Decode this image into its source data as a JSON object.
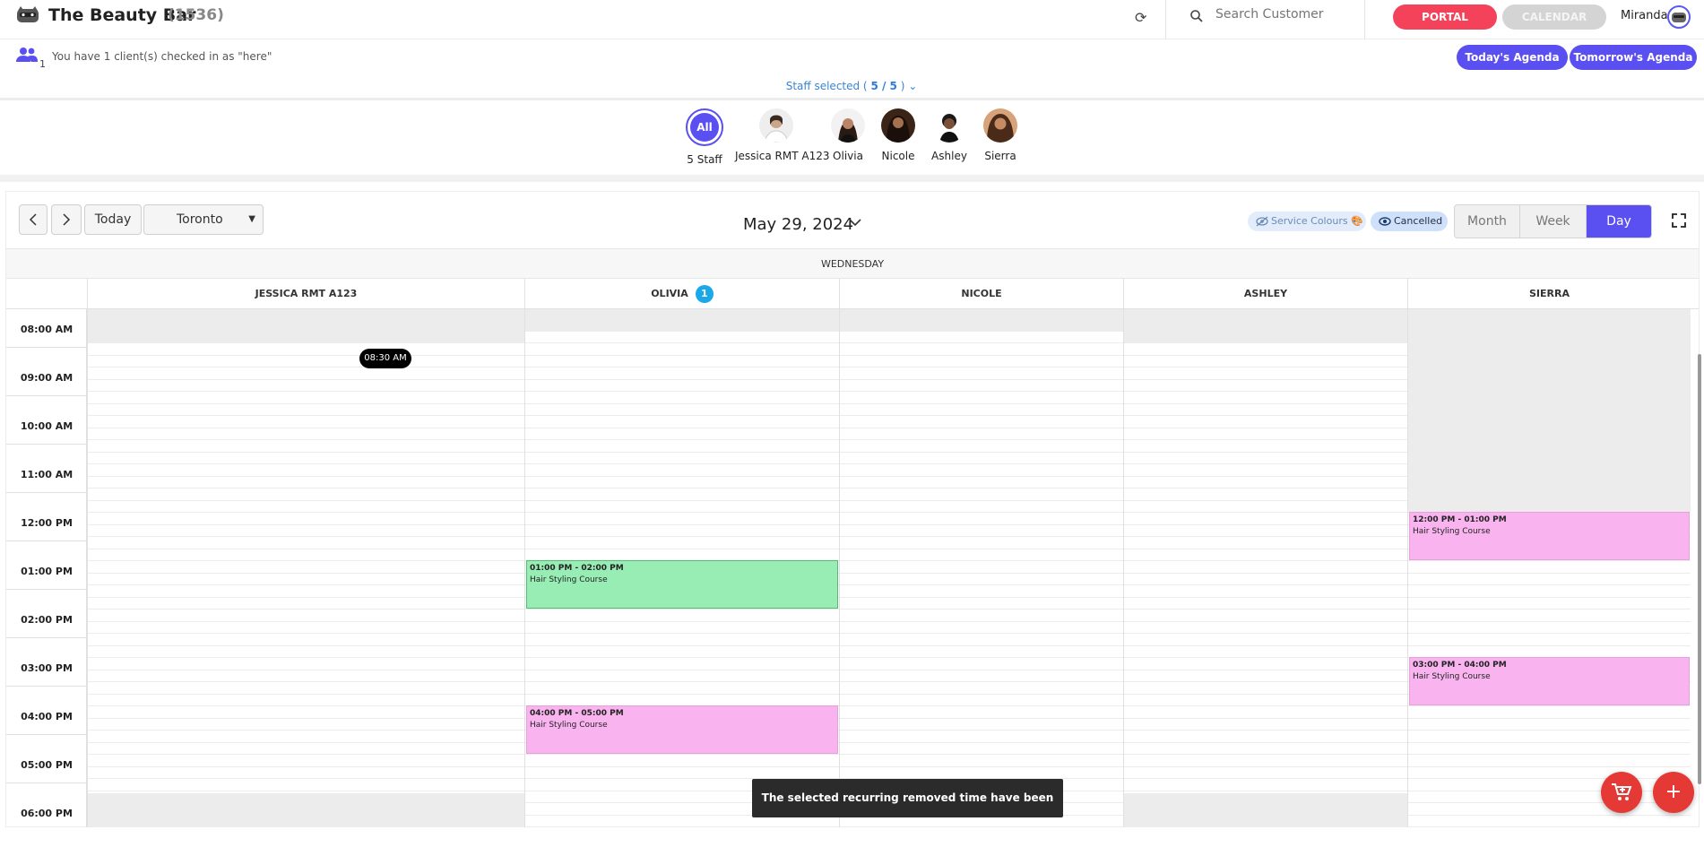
{
  "header": {
    "app_name": "The Beauty Bar",
    "app_count": "(1536)",
    "search_placeholder": "Search Customer",
    "portal_label": "PORTAL",
    "calendar_label": "CALENDAR",
    "user_name": "Miranda"
  },
  "infobar": {
    "checked_count": "1",
    "checked_text": "You have 1 client(s) checked in as \"here\"",
    "today_agenda": "Today's Agenda",
    "tomorrow_agenda": "Tomorrow's Agenda",
    "staff_selected_label": "Staff selected (",
    "staff_selected_value": "5 / 5",
    "staff_selected_close": ")"
  },
  "staff": [
    {
      "name": "5 Staff",
      "avatar": "All"
    },
    {
      "name": "Jessica RMT A123"
    },
    {
      "name": "Olivia"
    },
    {
      "name": "Nicole"
    },
    {
      "name": "Ashley"
    },
    {
      "name": "Sierra"
    }
  ],
  "toolbar": {
    "today_label": "Today",
    "timezone": "Toronto",
    "date": "May 29, 2024",
    "service_colours": "Service Colours 🎨",
    "cancelled": "Cancelled",
    "views": [
      "Month",
      "Week",
      "Day"
    ],
    "active_view": "Day"
  },
  "calendar": {
    "day_name": "WEDNESDAY",
    "columns": [
      {
        "name": "JESSICA RMT A123"
      },
      {
        "name": "OLIVIA",
        "badge": "1"
      },
      {
        "name": "NICOLE"
      },
      {
        "name": "ASHLEY"
      },
      {
        "name": "SIERRA"
      }
    ],
    "times": [
      "08:00 AM",
      "09:00 AM",
      "10:00 AM",
      "11:00 AM",
      "12:00 PM",
      "01:00 PM",
      "02:00 PM",
      "03:00 PM",
      "04:00 PM",
      "05:00 PM",
      "06:00 PM"
    ],
    "now_indicator": "08:30 AM",
    "appointments": [
      {
        "column": 1,
        "time": "01:00 PM - 02:00 PM",
        "title": "Hair Styling Course",
        "color": "#98edb5",
        "border": "#4fbf6f"
      },
      {
        "column": 1,
        "time": "04:00 PM - 05:00 PM",
        "title": "Hair Styling Course",
        "color": "#f9b4ef",
        "border": "#e6a0dc"
      },
      {
        "column": 4,
        "time": "12:00 PM - 01:00 PM",
        "title": "Hair Styling Course",
        "color": "#f9b4ef",
        "border": "#e6a0dc"
      },
      {
        "column": 4,
        "time": "03:00 PM - 04:00 PM",
        "title": "Hair Styling Course",
        "color": "#f9b4ef",
        "border": "#e6a0dc"
      }
    ]
  },
  "toast": "The selected recurring removed time have been cancelled!",
  "colors": {
    "accent": "#5a4ff0",
    "portal": "#f4425a",
    "fab": "#e53935"
  }
}
